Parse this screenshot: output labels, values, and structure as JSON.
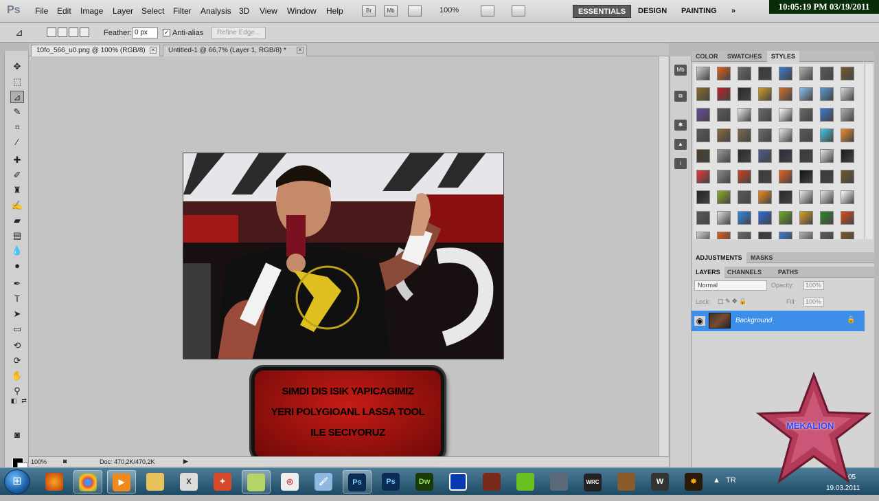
{
  "app": {
    "logo": "Ps",
    "zoom": "100%"
  },
  "menu": [
    "File",
    "Edit",
    "Image",
    "Layer",
    "Select",
    "Filter",
    "Analysis",
    "3D",
    "View",
    "Window",
    "Help"
  ],
  "menubar_icons": [
    "Br",
    "Mb"
  ],
  "workspaces": {
    "essentials": "ESSENTIALS",
    "design": "DESIGN",
    "painting": "PAINTING",
    "more": "»"
  },
  "clock": "10:05:19 PM 03/19/2011",
  "options": {
    "feather_label": "Feather:",
    "feather_value": "0 px",
    "antialias_label": "Anti-alias",
    "antialias_checked": "✓",
    "refine_edge": "Refine Edge..."
  },
  "tabs": [
    {
      "label": "10fo_566_u0.png @ 100% (RGB/8)",
      "close": "×"
    },
    {
      "label": "Untitled-1 @ 66,7% (Layer 1, RGB/8) *",
      "close": "×"
    }
  ],
  "status": {
    "zoom": "100%",
    "doc": "Doc: 470,2K/470,2K"
  },
  "caption": [
    "SIMDI DIS ISIK YAPICAGIMIZ",
    "YERI POLYGIOANL LASSA TOOL",
    "ILE SECIYORUZ"
  ],
  "dock": {
    "icon1": "Mb"
  },
  "panels": {
    "tabs_top": [
      "COLOR",
      "SWATCHES",
      "STYLES"
    ],
    "tabs_adj": [
      "ADJUSTMENTS",
      "MASKS"
    ],
    "tabs_layers": [
      "LAYERS",
      "CHANNELS",
      "PATHS"
    ],
    "blend_mode": "Normal",
    "opacity_label": "Opacity:",
    "opacity_value": "100%",
    "lock_label": "Lock:",
    "fill_label": "Fill:",
    "fill_value": "100%",
    "layer_name": "Background"
  },
  "taskbar": {
    "start": "⊞",
    "apps": [
      "Ps",
      "Ps",
      "Dw"
    ],
    "lang": "TR",
    "time": "05",
    "date": "19.03.2011"
  },
  "watermark_text": "MEKALION",
  "colors": {
    "accent": "#3d8ee8",
    "caption_red": "#c81c16",
    "clock_bg": "#082d08"
  }
}
